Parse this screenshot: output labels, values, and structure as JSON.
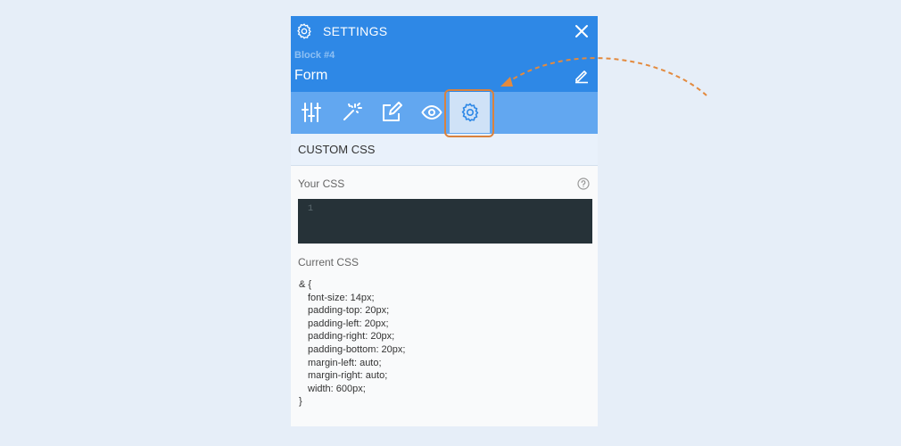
{
  "header": {
    "title": "SETTINGS",
    "block_label": "Block #4",
    "block_name": "Form"
  },
  "toolbar": {
    "tools": [
      {
        "icon": "sliders-icon"
      },
      {
        "icon": "magic-wand-icon"
      },
      {
        "icon": "edit-square-icon"
      },
      {
        "icon": "eye-icon"
      },
      {
        "icon": "gear-icon",
        "active": true
      }
    ]
  },
  "custom_css": {
    "section_title": "CUSTOM CSS",
    "your_css_label": "Your CSS",
    "editor_line_number": "1",
    "current_css_label": "Current CSS",
    "current_css_lines": [
      "& {",
      "font-size: 14px;",
      "padding-top: 20px;",
      "padding-left: 20px;",
      "padding-right: 20px;",
      "padding-bottom: 20px;",
      "margin-left: auto;",
      "margin-right: auto;",
      "width: 600px;",
      "}"
    ]
  },
  "colors": {
    "header_bg": "#2e88e6",
    "toolbar_bg": "#62a7f0",
    "highlight": "#d9823e",
    "editor_bg": "#263238"
  }
}
